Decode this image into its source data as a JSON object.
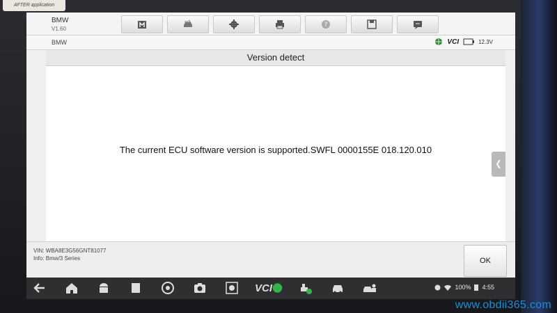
{
  "sticker": {
    "text": "AFTER application completed"
  },
  "app": {
    "brand": "BMW",
    "version": "V1.60",
    "make": "BMW"
  },
  "toolbar": {
    "buttons": [
      {
        "icon": "home-icon"
      },
      {
        "icon": "vehicle-swap-icon"
      },
      {
        "icon": "gear-icon"
      },
      {
        "icon": "printer-icon"
      },
      {
        "icon": "help-icon"
      },
      {
        "icon": "save-icon"
      },
      {
        "icon": "message-icon"
      }
    ]
  },
  "status": {
    "vci_label": "VCI",
    "battery_voltage": "12.3V"
  },
  "dialog": {
    "title": "Version detect",
    "message": "The current ECU software version is supported.SWFL 0000155E 018.120.010"
  },
  "vehicle": {
    "vin": "VIN: WBA8E3G56GNT81077",
    "info": "Info: Bmw/3 Series"
  },
  "actions": {
    "ok_label": "OK"
  },
  "navbar": {
    "vci_label": "VCI",
    "tray": {
      "battery": "100%",
      "time": "4:55"
    }
  },
  "watermark": {
    "text": "www.obdii365.com"
  },
  "colors": {
    "watermark": "#1a8fd6",
    "navbar": "#2f2f31"
  }
}
